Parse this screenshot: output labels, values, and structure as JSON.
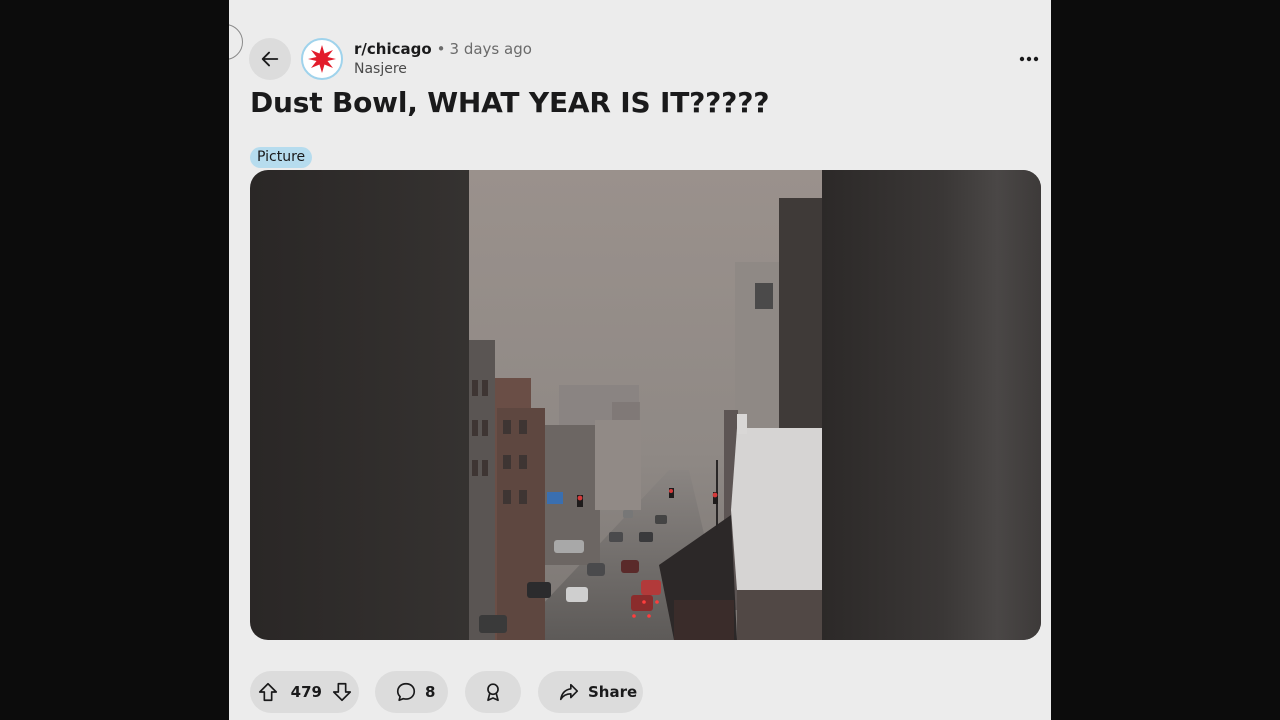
{
  "post": {
    "subreddit": "r/chicago",
    "separator": "•",
    "time_ago": "3 days ago",
    "author": "Nasjere",
    "title": "Dust Bowl, WHAT YEAR IS IT?????",
    "flair": "Picture"
  },
  "actions": {
    "upvotes": "479",
    "comments": "8",
    "share_label": "Share"
  },
  "icons": {
    "back": "back-arrow-icon",
    "avatar": "chicago-star-icon",
    "more": "more-options-icon",
    "upvote": "upvote-icon",
    "downvote": "downvote-icon",
    "comment": "comment-icon",
    "award": "award-icon",
    "share": "share-icon"
  },
  "colors": {
    "panel_bg": "#ececec",
    "pill_bg": "#dcdcdc",
    "flair_bg": "#b6dcee",
    "star_red": "#e21b2b",
    "avatar_border": "#9fd3ec"
  }
}
